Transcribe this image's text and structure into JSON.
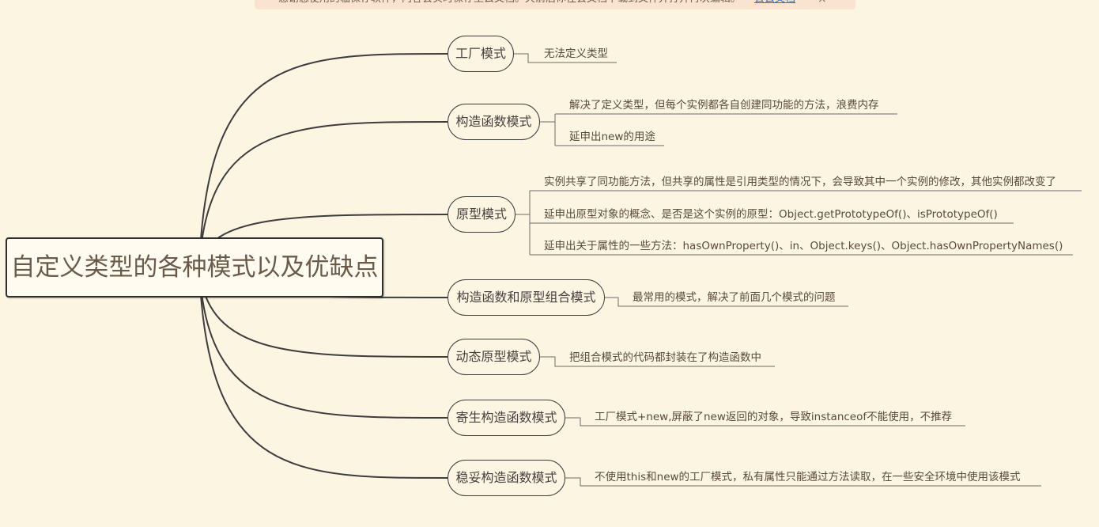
{
  "banner": {
    "text": "感谢您使用的临保存软件，内容会实时保存至云文档。天前后你往会文档下载到文件并打开再次编辑。",
    "link": "去云文档",
    "close": "×"
  },
  "mindmap": {
    "root": "自定义类型的各种模式以及优缺点",
    "branches": [
      {
        "label": "工厂模式",
        "notes": [
          "无法定义类型"
        ]
      },
      {
        "label": "构造函数模式",
        "notes": [
          "解决了定义类型，但每个实例都各自创建同功能的方法，浪费内存",
          "延申出new的用途"
        ]
      },
      {
        "label": "原型模式",
        "notes": [
          "实例共享了同功能方法，但共享的属性是引用类型的情况下，会导致其中一个实例的修改，其他实例都改变了",
          "延申出原型对象的概念、是否是这个实例的原型：Object.getPrototypeOf()、isPrototypeOf()",
          "延申出关于属性的一些方法：hasOwnProperty()、in、Object.keys()、Object.hasOwnPropertyNames()"
        ]
      },
      {
        "label": "构造函数和原型组合模式",
        "notes": [
          "最常用的模式，解决了前面几个模式的问题"
        ]
      },
      {
        "label": "动态原型模式",
        "notes": [
          "把组合模式的代码都封装在了构造函数中"
        ]
      },
      {
        "label": "寄生构造函数模式",
        "notes": [
          "工厂模式+new,屏蔽了new返回的对象，导致instanceof不能使用，不推荐"
        ]
      },
      {
        "label": "稳妥构造函数模式",
        "notes": [
          "不使用this和new的工厂模式，私有属性只能通过方法读取，在一些安全环境中使用该模式"
        ]
      }
    ]
  }
}
